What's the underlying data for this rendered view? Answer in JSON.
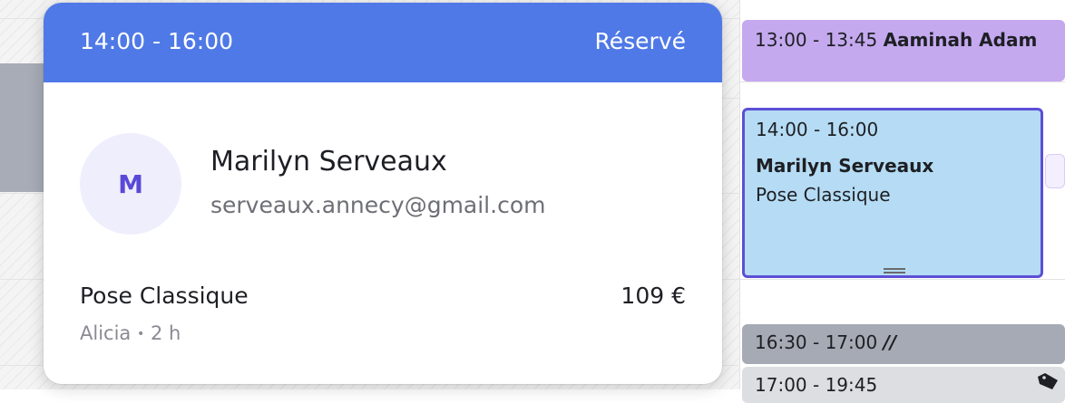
{
  "popover": {
    "time_range": "14:00 - 16:00",
    "status": "Réservé",
    "avatar_initial": "M",
    "client_name": "Marilyn Serveaux",
    "client_email": "serveaux.annecy@gmail.com",
    "service_name": "Pose Classique",
    "price": "109 €",
    "staff": "Alicia",
    "separator": "•",
    "duration": "2 h"
  },
  "calendar": {
    "events": [
      {
        "time": "13:00 - 13:45",
        "client": "Aaminah Adam",
        "color": "#c4a9ef"
      },
      {
        "time": "14:00 - 16:00",
        "client": "Marilyn Serveaux",
        "service": "Pose Classique",
        "color": "#b5dcf4"
      },
      {
        "time": "16:30 - 17:00",
        "marker": "//",
        "color": "#a6aab4"
      },
      {
        "time": "17:00 - 19:45",
        "icon": "tag-icon",
        "color": "#dcdee2"
      }
    ]
  },
  "colors": {
    "header_blue": "#4f79e7",
    "selected_border": "#5c4fd6",
    "avatar_bg": "#efeefc",
    "avatar_text": "#5a49d8"
  }
}
